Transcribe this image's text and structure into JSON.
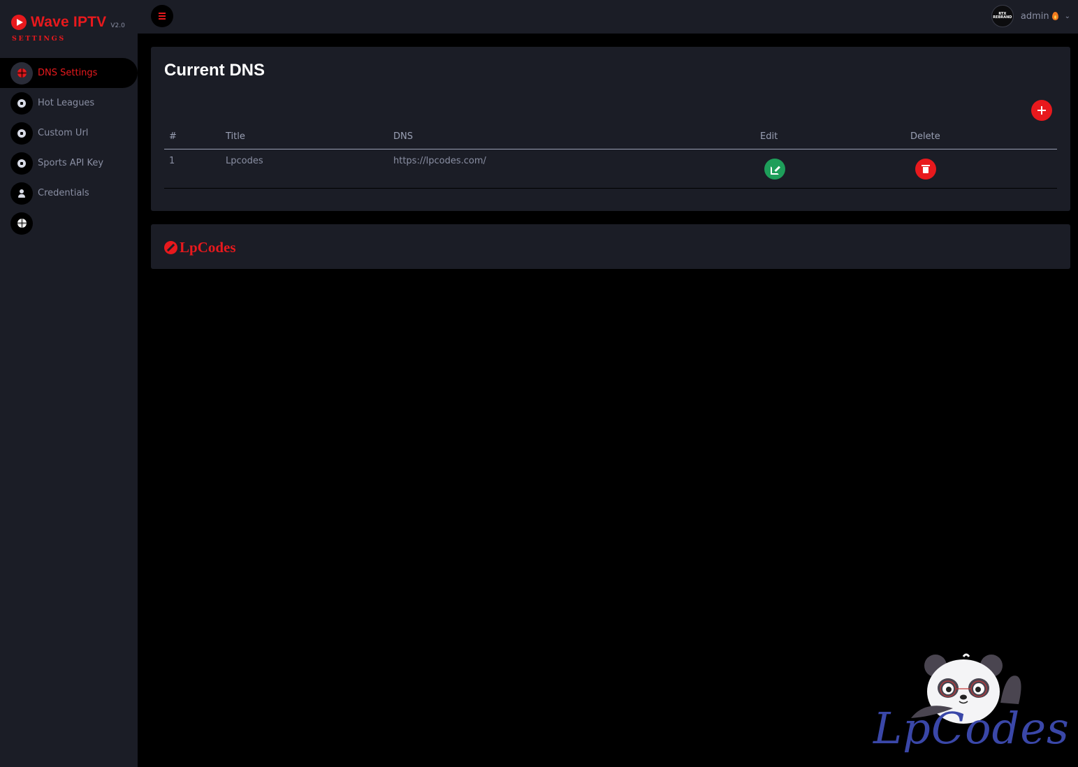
{
  "brand": {
    "name": "Wave IPTV",
    "version": "V2.0",
    "subtitle": "SETTINGS"
  },
  "sidebar": {
    "items": [
      {
        "label": "DNS Settings",
        "icon": "globe-icon",
        "active": true
      },
      {
        "label": "Hot Leagues",
        "icon": "soccer-ball-icon"
      },
      {
        "label": "Custom Url",
        "icon": "soccer-ball-icon"
      },
      {
        "label": "Sports API Key",
        "icon": "soccer-ball-icon"
      },
      {
        "label": "Credentials",
        "icon": "user-icon"
      },
      {
        "label": "",
        "icon": "globe-icon"
      }
    ]
  },
  "topbar": {
    "menu_icon": "hamburger-icon",
    "avatar_text": "RTX REBRAND",
    "user": "admin",
    "user_icon": "flame-icon",
    "dropdown_icon": "chevron-down-icon"
  },
  "dns_card": {
    "title": "Current DNS",
    "add_icon": "plus-icon",
    "columns": [
      "#",
      "Title",
      "DNS",
      "Edit",
      "Delete"
    ],
    "rows": [
      {
        "num": "1",
        "title": "Lpcodes",
        "dns": "https://lpcodes.com/"
      }
    ]
  },
  "footer": {
    "brand": "LpCodes",
    "icon": "compass-icon"
  },
  "watermark": {
    "text": "LpCodes"
  },
  "colors": {
    "accent": "#e8191d",
    "panel": "#1b1d26",
    "background": "#000000",
    "edit": "#1e9e5a",
    "watermark": "#3a47a8"
  }
}
